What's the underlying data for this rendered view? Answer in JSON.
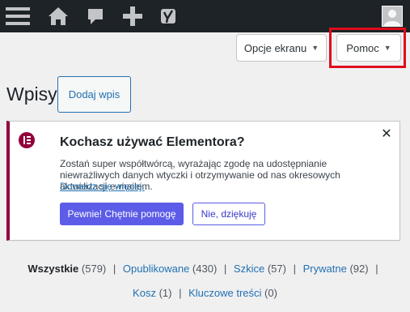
{
  "adminbar": {
    "icons": [
      "menu-icon",
      "home-icon",
      "comments-icon",
      "plus-icon",
      "yoast-icon",
      "avatar"
    ],
    "background": "#1d2327"
  },
  "screen_options": {
    "label": "Opcje ekranu"
  },
  "help": {
    "label": "Pomoc"
  },
  "highlight_color": "#e00b1c",
  "page": {
    "title": "Wpisy",
    "add_new": "Dodaj wpis"
  },
  "notice": {
    "title": "Kochasz używać Elementora?",
    "text": "Zostań super współtwórcą, wyrażając zgodę na udostępnianie niewrażliwych danych wtyczki i otrzymywanie od nas okresowych aktualizacji e-mailem.",
    "link": "Dowiedz się więcej.",
    "accept": "Pewnie! Chętnie pomogę",
    "decline": "Nie, dziękuję",
    "accent": "#92003b",
    "button_color": "#5c5ce8"
  },
  "filters": [
    {
      "label": "Wszystkie",
      "count": "(579)",
      "current": true
    },
    {
      "label": "Opublikowane",
      "count": "(430)"
    },
    {
      "label": "Szkice",
      "count": "(57)"
    },
    {
      "label": "Prywatne",
      "count": "(92)"
    },
    {
      "label": "Kosz",
      "count": "(1)"
    },
    {
      "label": "Kluczowe treści",
      "count": "(0)"
    }
  ]
}
